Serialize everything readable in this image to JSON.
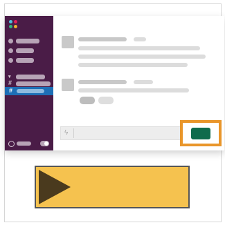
{
  "icons": {
    "workspace_logo": "workspace-logo-icon",
    "shortcut": "lightning-bolt-icon",
    "play": "play-icon"
  },
  "glyphs": {
    "hash": "#",
    "bolt": "ϟ"
  },
  "colors": {
    "sidebar": "#4a1c47",
    "active_channel": "#1d6fb6",
    "send_button": "#0f6b4c",
    "highlight": "#e9962b",
    "play_bar": "#f5c24f",
    "play_triangle": "#4a3a1e",
    "logo_dots": [
      "#4ec1e0",
      "#e01e5a",
      "#2eb67d",
      "#ecb22e"
    ]
  }
}
